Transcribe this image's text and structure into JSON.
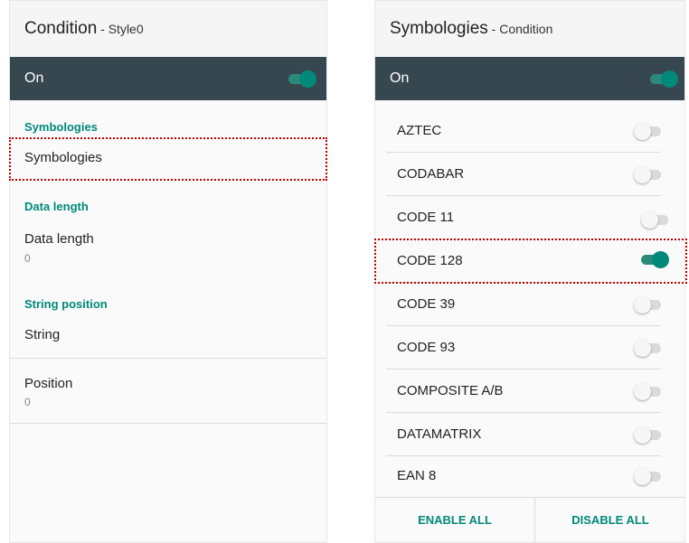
{
  "left": {
    "title": "Condition",
    "subtitle": " - Style0",
    "on_label": "On",
    "sections": {
      "symbologies": "Symbologies",
      "data_length": "Data length",
      "string_position": "String position"
    },
    "items": {
      "symbologies": {
        "title": "Symbologies"
      },
      "data_length": {
        "title": "Data length",
        "value": "0"
      },
      "string": {
        "title": "String"
      },
      "position": {
        "title": "Position",
        "value": "0"
      }
    }
  },
  "right": {
    "title": "Symbologies",
    "subtitle": " - Condition",
    "on_label": "On",
    "symbologies": [
      {
        "name": "AZTEC",
        "enabled": false
      },
      {
        "name": "CODABAR",
        "enabled": false
      },
      {
        "name": "CODE 11",
        "enabled": false
      },
      {
        "name": "CODE 128",
        "enabled": true
      },
      {
        "name": "CODE 39",
        "enabled": false
      },
      {
        "name": "CODE 93",
        "enabled": false
      },
      {
        "name": "COMPOSITE A/B",
        "enabled": false
      },
      {
        "name": "DATAMATRIX",
        "enabled": false
      },
      {
        "name": "EAN 8",
        "enabled": false
      }
    ],
    "enable_all": "ENABLE ALL",
    "disable_all": "DISABLE ALL"
  },
  "colors": {
    "accent": "#00897b",
    "on_bar": "#37474f",
    "highlight": "#c00000"
  }
}
